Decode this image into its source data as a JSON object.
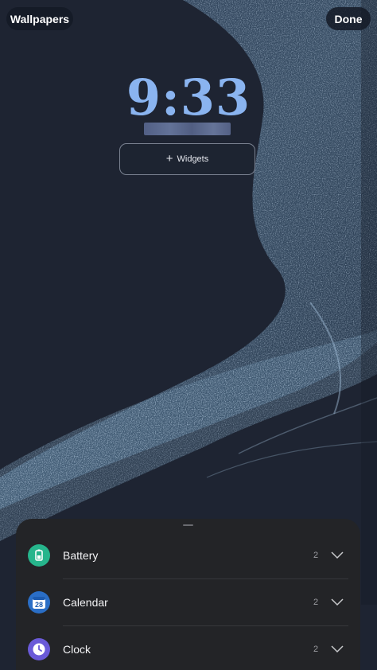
{
  "header": {
    "wallpapers_label": "Wallpapers",
    "done_label": "Done"
  },
  "lockscreen": {
    "time": "9:33",
    "widgets_button": {
      "plus": "+",
      "label": "Widgets"
    }
  },
  "widget_sheet": {
    "items": [
      {
        "label": "Battery",
        "count": "2",
        "icon": "battery-icon",
        "icon_color": "#26b58c"
      },
      {
        "label": "Calendar",
        "count": "2",
        "icon": "calendar-icon",
        "icon_color": "#2a6ec6",
        "icon_text": "28"
      },
      {
        "label": "Clock",
        "count": "2",
        "icon": "clock-icon",
        "icon_color": "#6a5ad8"
      }
    ]
  },
  "colors": {
    "clock_text": "#8ab4f0",
    "background": "#1e2432",
    "sheet": "#232427"
  }
}
